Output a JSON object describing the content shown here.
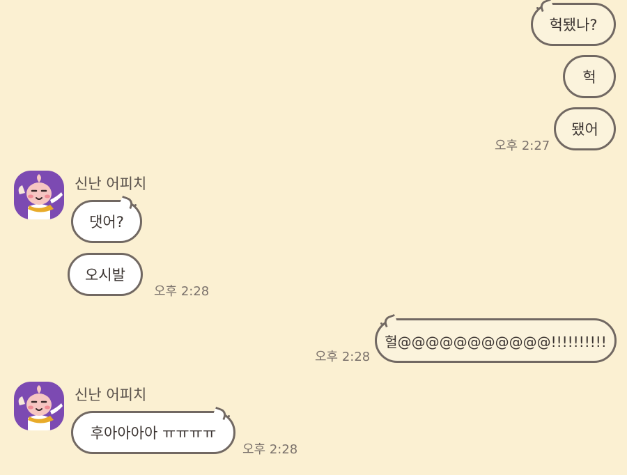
{
  "colors": {
    "background": "#fbf0d2",
    "my_bubble": "#fbf3dc",
    "their_bubble": "#ffffff",
    "bubble_border": "#716862",
    "avatar_bg": "#7c4ab2"
  },
  "messages": {
    "m1": "헉됐나?",
    "m2": "헉",
    "m3": "됐어",
    "t1": "오후 2:27",
    "sender1": "신난 어피치",
    "m4": "댓어?",
    "m5": "오시발",
    "t2": "오후 2:28",
    "m6": "헐@@@@@@@@@@@!!!!!!!!!!",
    "t3": "오후 2:28",
    "sender2": "신난 어피치",
    "m7": "후아아아아 ㅠㅠㅠㅠ",
    "t4": "오후 2:28"
  },
  "avatar_icon": "apeach-character-icon"
}
